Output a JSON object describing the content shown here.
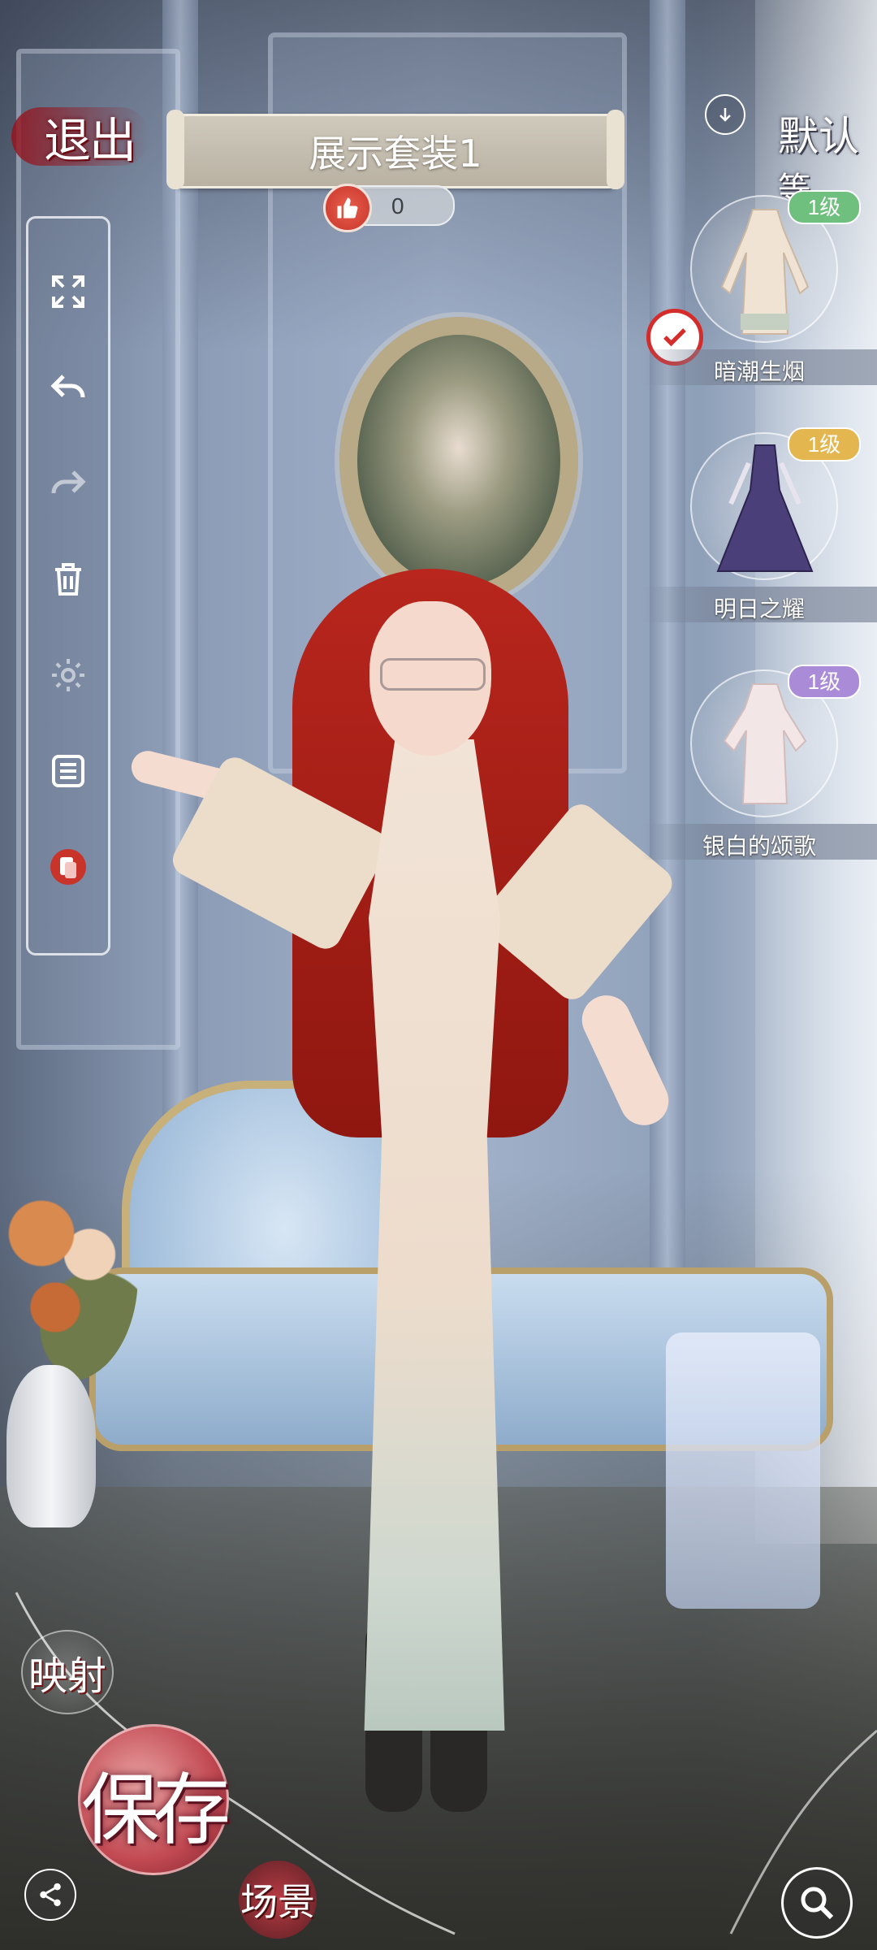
{
  "header": {
    "exit_label": "退出",
    "outfit_title": "展示套装1",
    "like_count": "0",
    "default_label": "默认",
    "default_label_extra": "等"
  },
  "toolbar": {
    "items": [
      {
        "icon": "fullscreen-icon"
      },
      {
        "icon": "undo-icon"
      },
      {
        "icon": "redo-icon"
      },
      {
        "icon": "trash-icon"
      },
      {
        "icon": "gear-icon"
      },
      {
        "icon": "list-icon"
      },
      {
        "icon": "photo-swap-icon"
      }
    ]
  },
  "outfits": [
    {
      "name": "暗潮生烟",
      "level": "1级",
      "badge_color": "#6fbf7e",
      "selected": true
    },
    {
      "name": "明日之耀",
      "level": "1级",
      "badge_color": "#e3b64f",
      "selected": false
    },
    {
      "name": "银白的颂歌",
      "level": "1级",
      "badge_color": "#a98bd8",
      "selected": false
    }
  ],
  "bottom": {
    "map_label": "映射",
    "save_label": "保存",
    "scene_label": "场景"
  },
  "colors": {
    "accent_red": "#c8342a",
    "save_red": "#c24a53"
  }
}
